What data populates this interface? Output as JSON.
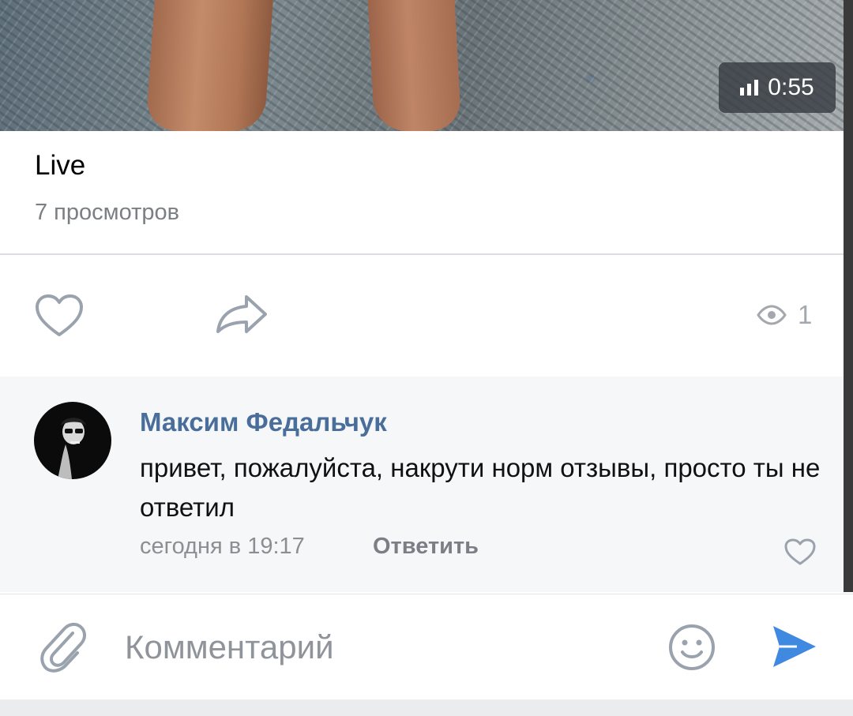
{
  "video": {
    "duration": "0:55",
    "title": "Live",
    "views": "7 просмотров"
  },
  "actions": {
    "like_icon": "heart-outline-icon",
    "share_icon": "share-arrow-icon",
    "view_icon": "eye-icon",
    "view_count": "1"
  },
  "comment": {
    "author": "Максим Федальчук",
    "text": "привет, пожалуйста, накрути норм отзывы, просто ты не ответил",
    "time": "сегодня в 19:17",
    "reply_label": "Ответить"
  },
  "composer": {
    "placeholder": "Комментарий",
    "send_color": "#3f8ae0"
  },
  "colors": {
    "link": "#4a6e9a",
    "secondary": "#8b8f94",
    "accent": "#3f8ae0"
  }
}
